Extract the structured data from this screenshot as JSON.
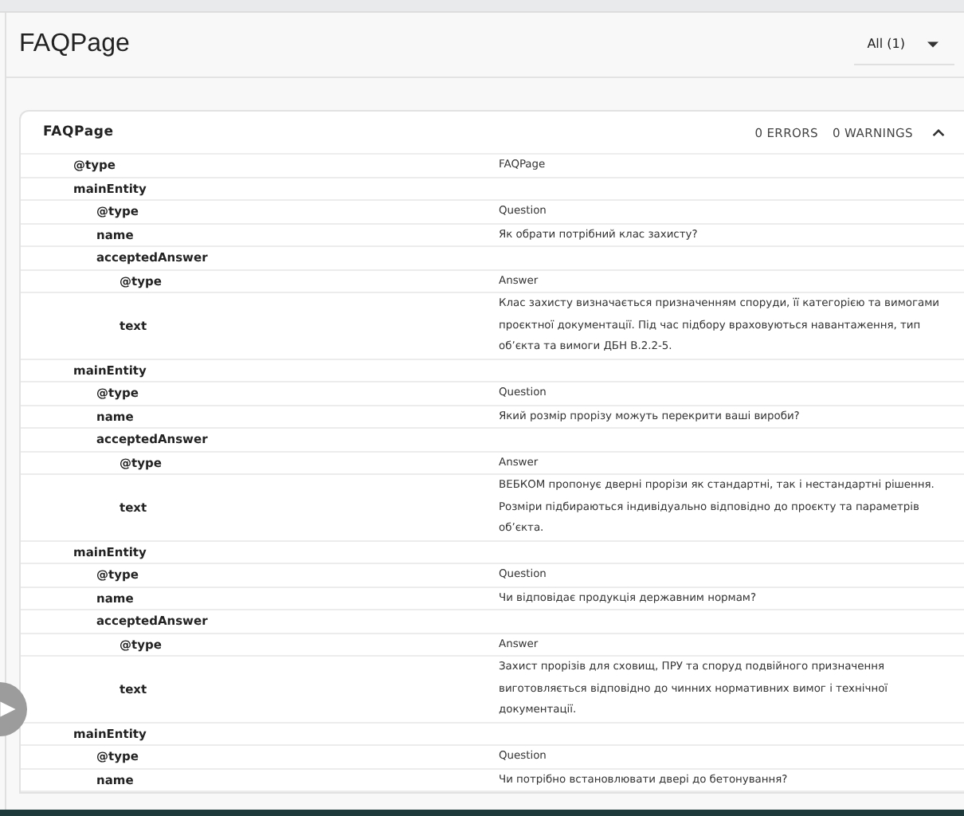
{
  "page": {
    "title": "FAQPage",
    "filter": "All (1)"
  },
  "card": {
    "title": "FAQPage",
    "errors": "0 ERRORS",
    "warnings": "0 WARNINGS",
    "expanded": true,
    "properties": [
      {
        "key": "@type",
        "value": "FAQPage"
      },
      {
        "key": "mainEntity",
        "children": [
          {
            "key": "@type",
            "value": "Question"
          },
          {
            "key": "name",
            "value": "Як обрати потрібний клас захисту?"
          },
          {
            "key": "acceptedAnswer",
            "children": [
              {
                "key": "@type",
                "value": "Answer"
              },
              {
                "key": "text",
                "value": "Клас захисту визначається призначенням споруди, її категорією та вимогами проєктної документації. Під час підбору враховуються навантаження, тип об’єкта та вимоги ДБН В.2.2-5."
              }
            ]
          }
        ]
      },
      {
        "key": "mainEntity",
        "children": [
          {
            "key": "@type",
            "value": "Question"
          },
          {
            "key": "name",
            "value": "Який розмір прорізу можуть перекрити ваші вироби?"
          },
          {
            "key": "acceptedAnswer",
            "children": [
              {
                "key": "@type",
                "value": "Answer"
              },
              {
                "key": "text",
                "value": "ВЕБКОМ пропонує дверні прорізи як стандартні, так і нестандартні рішення. Розміри підбираються індивідуально відповідно до проєкту та параметрів об’єкта."
              }
            ]
          }
        ]
      },
      {
        "key": "mainEntity",
        "children": [
          {
            "key": "@type",
            "value": "Question"
          },
          {
            "key": "name",
            "value": "Чи відповідає продукція державним нормам?"
          },
          {
            "key": "acceptedAnswer",
            "children": [
              {
                "key": "@type",
                "value": "Answer"
              },
              {
                "key": "text",
                "value": "Захист прорізів для сховищ, ПРУ та споруд подвійного призначення виготовляється відповідно до чинних нормативних вимог і технічної документації."
              }
            ]
          }
        ]
      },
      {
        "key": "mainEntity",
        "children": [
          {
            "key": "@type",
            "value": "Question"
          },
          {
            "key": "name",
            "value": "Чи потрібно встановлювати двері до бетонування?"
          }
        ]
      }
    ]
  }
}
